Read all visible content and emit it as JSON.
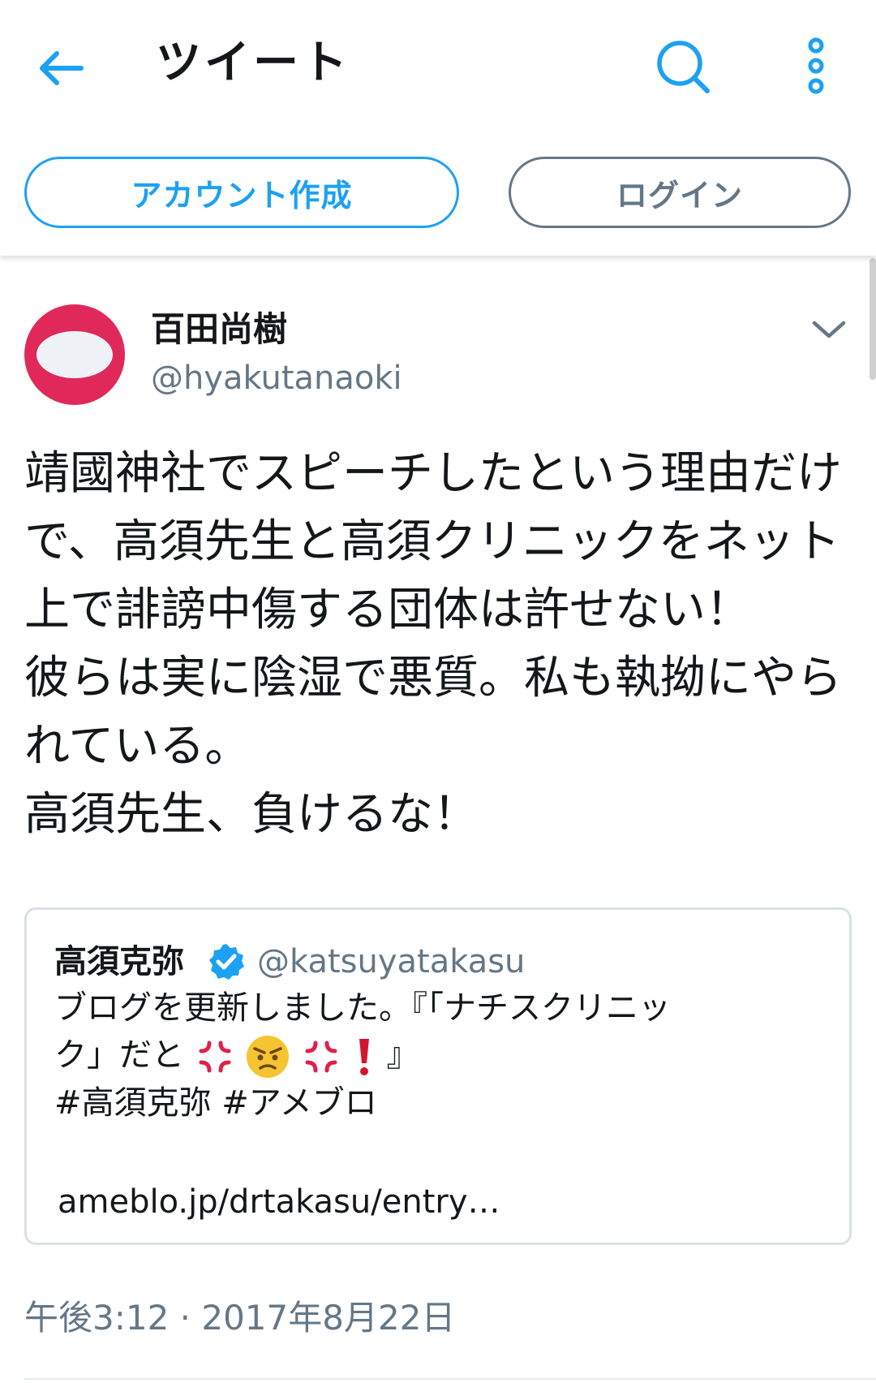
{
  "header": {
    "title": "ツイート",
    "back_icon": "arrow-left-icon",
    "search_icon": "search-icon",
    "more_icon": "more-vertical-icon",
    "signup_label": "アカウント作成",
    "login_label": "ログイン"
  },
  "tweet": {
    "display_name": "百田尚樹",
    "handle": "@hyakutanaoki",
    "avatar_colors": {
      "ring": "#e0295a",
      "center": "#eef2f6"
    },
    "caret_icon": "chevron-down-icon",
    "text_lines": [
      "靖國神社でスピーチしたという理由だけ",
      "で、高須先生と高須クリニックをネット",
      "上で誹謗中傷する団体は許せない！",
      "彼らは実に陰湿で悪質。私も執拗にやら",
      "れている。",
      "高須先生、負けるな！"
    ],
    "timestamp": "午後3:12 · 2017年8月22日"
  },
  "quoted_tweet": {
    "display_name": "高須克弥",
    "verified_icon": "verified-badge-icon",
    "handle": "@katsuyatakasu",
    "text_line1": "ブログを更新しました。『「ナチスクリニッ",
    "text_line2_prefix": "ク」だと",
    "text_line2_suffix": "』",
    "emojis": [
      "anger-symbol-icon",
      "angry-face-icon",
      "anger-symbol-icon",
      "exclamation-icon"
    ],
    "hashtags": "#高須克弥 #アメブロ",
    "link": "ameblo.jp/drtakasu/entry…"
  },
  "colors": {
    "accent": "#1da1f2",
    "secondary_text": "#657786",
    "primary_text": "#14171a",
    "border": "#d9e0e6"
  }
}
